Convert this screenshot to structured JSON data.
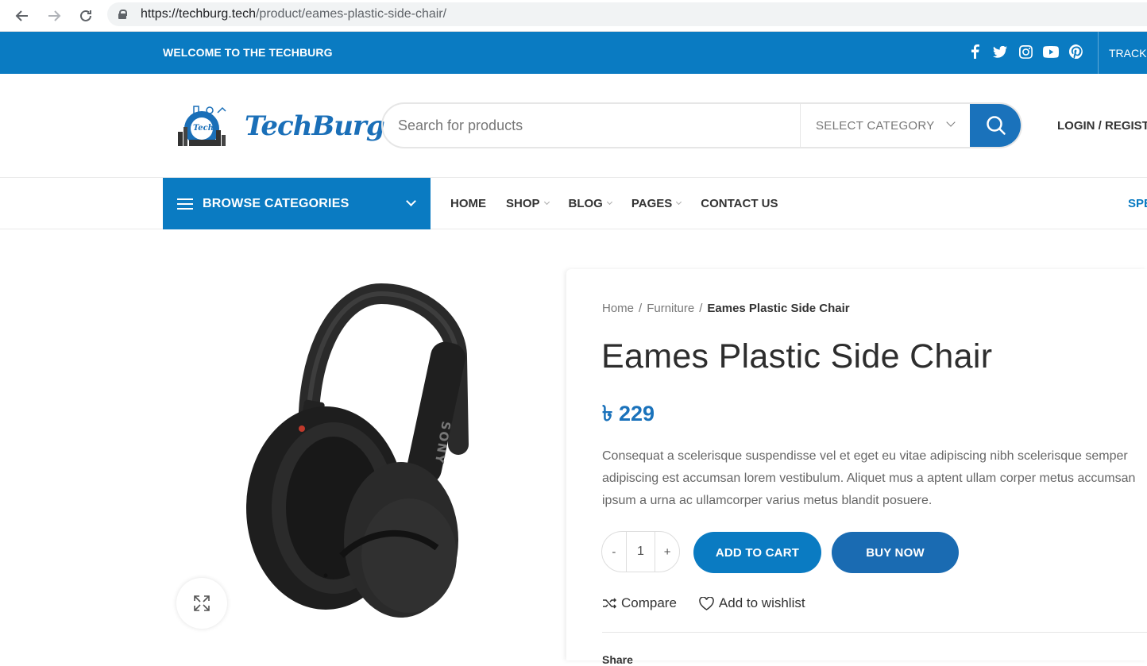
{
  "browser": {
    "url_host": "https://techburg.tech",
    "url_path": "/product/eames-plastic-side-chair/"
  },
  "topbar": {
    "welcome": "WELCOME TO THE TECHBURG",
    "socials": [
      "facebook-icon",
      "twitter-icon",
      "instagram-icon",
      "youtube-icon",
      "pinterest-icon"
    ],
    "track": "TRACK"
  },
  "header": {
    "logo_text": "TechBurg",
    "search_placeholder": "Search for products",
    "category_label": "SELECT CATEGORY",
    "login": "LOGIN / REGIST"
  },
  "nav": {
    "browse": "BROWSE CATEGORIES",
    "items": [
      {
        "label": "HOME"
      },
      {
        "label": "SHOP"
      },
      {
        "label": "BLOG"
      },
      {
        "label": "PAGES"
      },
      {
        "label": "CONTACT US"
      }
    ],
    "right_link": "SPE"
  },
  "product": {
    "breadcrumb": [
      "Home",
      "Furniture",
      "Eames Plastic Side Chair"
    ],
    "title": "Eames Plastic Side Chair",
    "price": "৳ 229",
    "description": [
      "Consequat a scelerisque suspendisse vel et eget eu vitae adipiscing nibh scelerisque semper",
      "adipiscing est accumsan lorem vestibulum. Aliquet mus a aptent ullam corper metus accumsan",
      "ipsum a urna ac ullamcorper varius metus blandit posuere."
    ],
    "qty_minus": "-",
    "quantity": "1",
    "qty_plus": "+",
    "add_to_cart": "ADD TO CART",
    "buy_now": "BUY NOW",
    "compare": "Compare",
    "wishlist": "Add to wishlist",
    "share": "Share"
  },
  "colors": {
    "brand_blue": "#0a7bc2",
    "button_blue": "#1a72bb"
  }
}
